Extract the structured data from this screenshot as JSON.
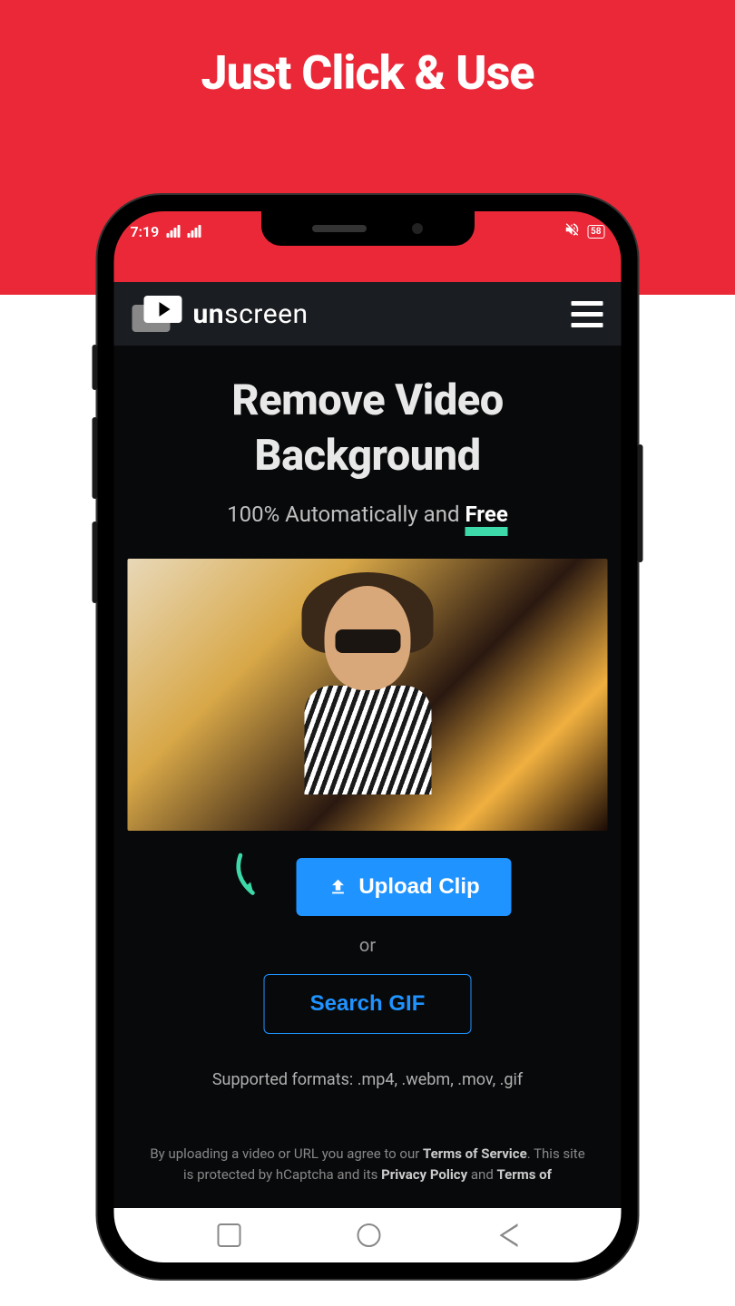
{
  "banner": {
    "title": "Just Click & Use"
  },
  "statusBar": {
    "time": "7:19",
    "battery": "58"
  },
  "header": {
    "brandBold": "un",
    "brandLight": "screen"
  },
  "main": {
    "heading": "Remove Video Background",
    "subtitlePrefix": "100% Automatically and ",
    "subtitleFree": "Free",
    "uploadLabel": "Upload Clip",
    "orLabel": "or",
    "searchGifLabel": "Search GIF",
    "formatsText": "Supported formats: .mp4, .webm, .mov, .gif"
  },
  "legal": {
    "prefix": "By uploading a video or URL you agree to our ",
    "tos": "Terms of Service",
    "middle1": ". This site is protected by hCaptcha and its ",
    "privacy": "Privacy Policy",
    "middle2": " and ",
    "termsOf": "Terms of"
  }
}
